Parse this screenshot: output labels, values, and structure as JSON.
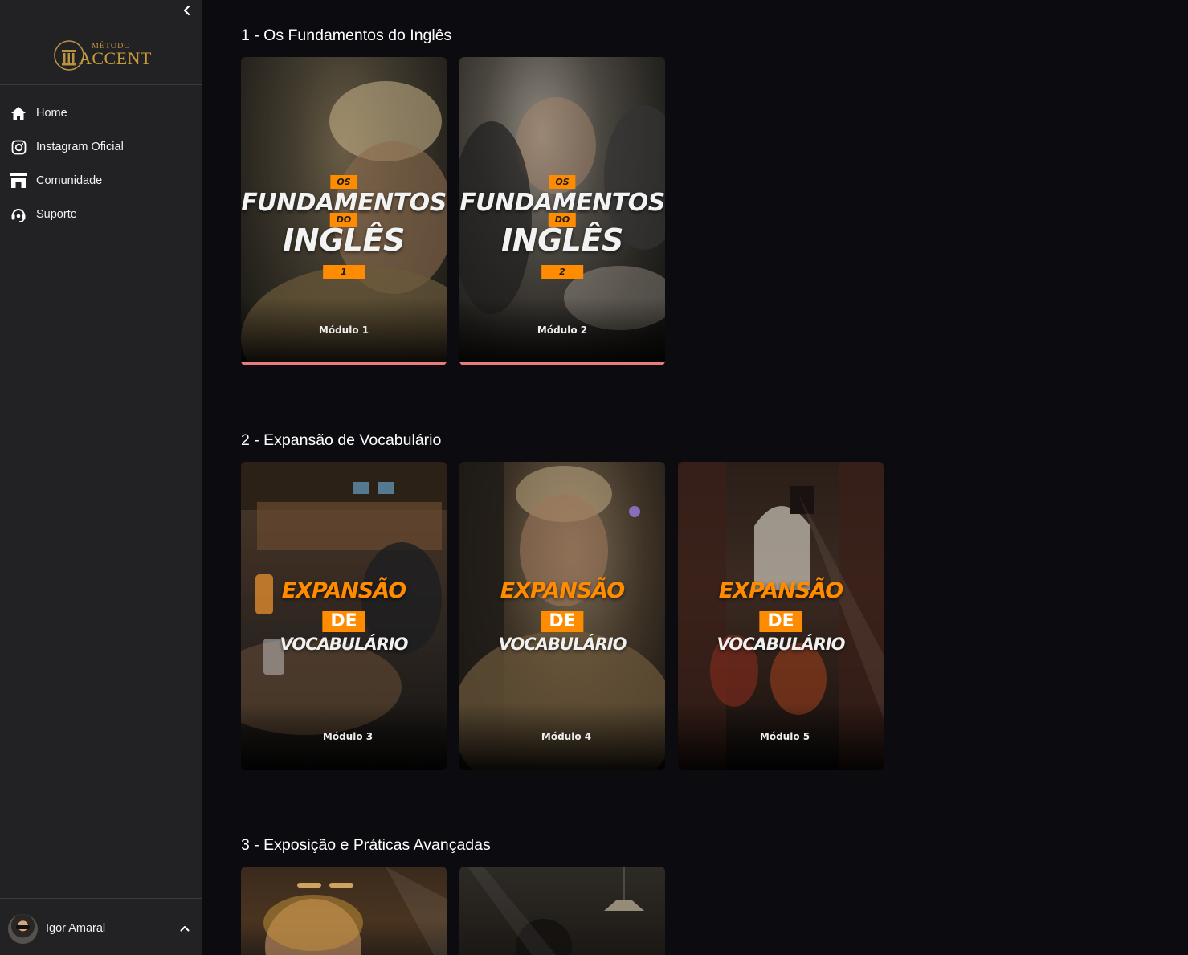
{
  "sidebar": {
    "logo": {
      "top": "MÉTODO",
      "main": "ACCENT"
    },
    "nav": [
      {
        "label": "Home",
        "icon": "home-icon"
      },
      {
        "label": "Instagram Oficial",
        "icon": "instagram-icon"
      },
      {
        "label": "Comunidade",
        "icon": "community-icon"
      },
      {
        "label": "Suporte",
        "icon": "headset-icon"
      }
    ],
    "user": {
      "name": "Igor Amaral"
    }
  },
  "sections": [
    {
      "title": "1 - Os Fundamentos do Inglês",
      "cards": [
        {
          "small_top": "OS",
          "line1": "FUNDAMENTOS",
          "small_mid": "DO",
          "line2": "INGLÊS",
          "number": "1",
          "label": "Módulo 1",
          "progress": 1.0
        },
        {
          "small_top": "OS",
          "line1": "FUNDAMENTOS",
          "small_mid": "DO",
          "line2": "INGLÊS",
          "number": "2",
          "label": "Módulo 2",
          "progress": 1.0
        }
      ]
    },
    {
      "title": "2 - Expansão de Vocabulário",
      "cards": [
        {
          "line1": "EXPANSÃO",
          "de": "DE",
          "line2": "VOCABULÁRIO",
          "label": "Módulo 3"
        },
        {
          "line1": "EXPANSÃO",
          "de": "DE",
          "line2": "VOCABULÁRIO",
          "label": "Módulo 4"
        },
        {
          "line1": "EXPANSÃO",
          "de": "DE",
          "line2": "VOCABULÁRIO",
          "label": "Módulo 5"
        }
      ]
    },
    {
      "title": "3 - Exposição e Práticas Avançadas",
      "cards": [
        {},
        {}
      ]
    }
  ],
  "colors": {
    "accent_orange": "#ff8c00",
    "progress": "#e87b7b",
    "sidebar_bg": "#222224",
    "main_bg": "#0c0b10"
  }
}
